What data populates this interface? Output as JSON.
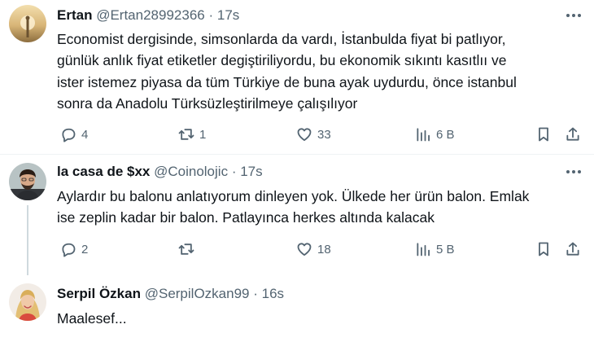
{
  "tweets": [
    {
      "name": "Ertan",
      "handle": "@Ertan28992366",
      "separator": "·",
      "time": "17s",
      "lines": [
        "Economist dergisinde, simsonlarda da vardı, İstanbulda fiyat bi patlıyor,",
        "günlük anlık fiyat etiketler degiştiriliyordu, bu ekonomik sıkıntı kasıtlıı ve",
        "ister istemez piyasa da tüm Türkiye de buna ayak uydurdu, önce istanbul",
        "sonra da Anadolu Türksüzleştirilmeye çalışılıyor"
      ],
      "replies": "4",
      "retweets": "1",
      "likes": "33",
      "views": "6 B"
    },
    {
      "name": "la casa de $xx",
      "handle": "@Coinolojic",
      "separator": "·",
      "time": "17s",
      "lines": [
        "Aylardır bu balonu anlatıyorum dinleyen yok. Ülkede her ürün balon. Emlak",
        "ise zeplin kadar bir balon. Patlayınca herkes altında kalacak"
      ],
      "replies": "2",
      "retweets": "",
      "likes": "18",
      "views": "5 B"
    },
    {
      "name": "Serpil Özkan",
      "handle": "@SerpilOzkan99",
      "separator": "·",
      "time": "16s",
      "lines": [
        "Maalesef..."
      ]
    }
  ],
  "icons": {
    "reply": "reply-icon",
    "retweet": "retweet-icon",
    "like": "heart-icon",
    "views": "views-icon",
    "bookmark": "bookmark-icon",
    "share": "share-icon",
    "more": "more-icon"
  },
  "colors": {
    "text": "#0f1419",
    "secondary": "#536471",
    "divider": "#eff3f4",
    "thread_line": "#cfd9de"
  }
}
